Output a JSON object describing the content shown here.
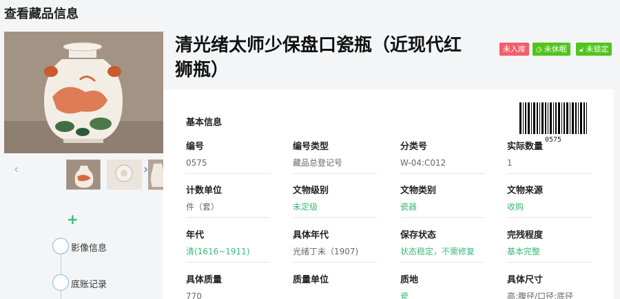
{
  "page": {
    "title": "查看藏品信息"
  },
  "relic": {
    "name": "清光绪太师少保盘口瓷瓶（近现代红狮瓶）",
    "badges": [
      {
        "label": "未入库",
        "icon": "",
        "color": "#f25e6b"
      },
      {
        "label": "未休眠",
        "icon": "clock-icon",
        "color": "#52c41a"
      },
      {
        "label": "未锁定",
        "icon": "lock-icon",
        "color": "#52c41a"
      }
    ],
    "barcode_number": "0575"
  },
  "gallery": {
    "prev_icon": "‹",
    "next_icon": "›"
  },
  "sidebar": {
    "add_icon": "+",
    "items": [
      {
        "label": "影像信息"
      },
      {
        "label": "底账记录"
      }
    ]
  },
  "basic_info": {
    "title": "基本信息",
    "rows": [
      [
        {
          "label": "编号",
          "value": "0575",
          "style": "gray"
        },
        {
          "label": "编号类型",
          "value": "藏品总登记号",
          "style": "gray"
        },
        {
          "label": "分类号",
          "value": "W-04:C012",
          "style": "gray"
        },
        {
          "label": "实际数量",
          "value": "1",
          "style": "gray"
        }
      ],
      [
        {
          "label": "计数单位",
          "value": "件（套）",
          "style": "gray"
        },
        {
          "label": "文物级别",
          "value": "未定级",
          "style": "green"
        },
        {
          "label": "文物类别",
          "value": "瓷器",
          "style": "green"
        },
        {
          "label": "文物来源",
          "value": "收购",
          "style": "green"
        }
      ],
      [
        {
          "label": "年代",
          "value": "清(1616~1911)",
          "style": "green"
        },
        {
          "label": "具体年代",
          "value": "光绪丁未（1907)",
          "style": "gray"
        },
        {
          "label": "保存状态",
          "value": "状态稳定，不需修复",
          "style": "green"
        },
        {
          "label": "完残程度",
          "value": "基本完整",
          "style": "green"
        }
      ],
      [
        {
          "label": "具体质量",
          "value": "770",
          "style": "gray"
        },
        {
          "label": "质量单位",
          "value": "",
          "style": "gray"
        },
        {
          "label": "质地",
          "value": "瓷",
          "style": "green"
        },
        {
          "label": "具体尺寸",
          "value": "高:腹径/口径:底径",
          "style": "gray"
        }
      ]
    ]
  }
}
